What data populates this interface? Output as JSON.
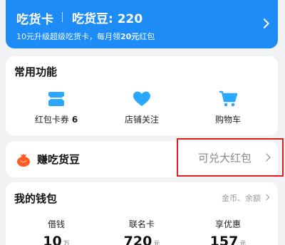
{
  "banner": {
    "title": "吃货卡",
    "beans": "吃货豆: 220",
    "subtitle_prefix": "10元升级超级吃货卡，每月领",
    "subtitle_highlight": "20元",
    "subtitle_suffix": "红包"
  },
  "common_functions": {
    "title": "常用功能",
    "items": [
      {
        "label": "红包卡券",
        "count": "6",
        "icon": "ticket-icon"
      },
      {
        "label": "店铺关注",
        "icon": "heart-icon"
      },
      {
        "label": "购物车",
        "icon": "cart-icon"
      }
    ]
  },
  "earn_beans": {
    "label": "赚吃货豆",
    "redeem_label": "可兑大红包",
    "icon": "money-bag-icon"
  },
  "wallet": {
    "title": "我的钱包",
    "more": "金币、余额",
    "items": [
      {
        "label": "借钱",
        "value": "10",
        "unit": "万"
      },
      {
        "label": "联名卡",
        "value": "720",
        "unit": "元"
      },
      {
        "label": "享优惠",
        "value": "157",
        "unit": "元"
      }
    ]
  },
  "colors": {
    "banner": "#1e8cf6",
    "icon_blue": "#2aa8ff",
    "highlight_box": "#e21d1d",
    "bag_orange": "#ff5a1f"
  }
}
